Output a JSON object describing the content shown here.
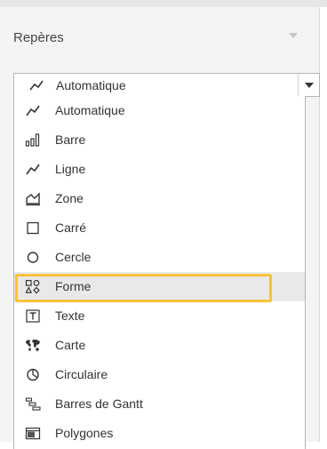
{
  "panel": {
    "title": "Repères"
  },
  "select": {
    "value": "Automatique",
    "icon": "line-chart-icon"
  },
  "menu": {
    "selected_index": 6,
    "highlight_color": "#f7c33c",
    "items": [
      {
        "label": "Automatique",
        "icon": "line-chart-icon"
      },
      {
        "label": "Barre",
        "icon": "bar-chart-icon"
      },
      {
        "label": "Ligne",
        "icon": "line-chart-icon"
      },
      {
        "label": "Zone",
        "icon": "area-chart-icon"
      },
      {
        "label": "Carré",
        "icon": "square-icon"
      },
      {
        "label": "Cercle",
        "icon": "circle-icon"
      },
      {
        "label": "Forme",
        "icon": "shapes-icon"
      },
      {
        "label": "Texte",
        "icon": "text-icon"
      },
      {
        "label": "Carte",
        "icon": "map-icon"
      },
      {
        "label": "Circulaire",
        "icon": "pie-chart-icon"
      },
      {
        "label": "Barres de Gantt",
        "icon": "gantt-icon"
      },
      {
        "label": "Polygones",
        "icon": "polygon-icon"
      }
    ]
  }
}
